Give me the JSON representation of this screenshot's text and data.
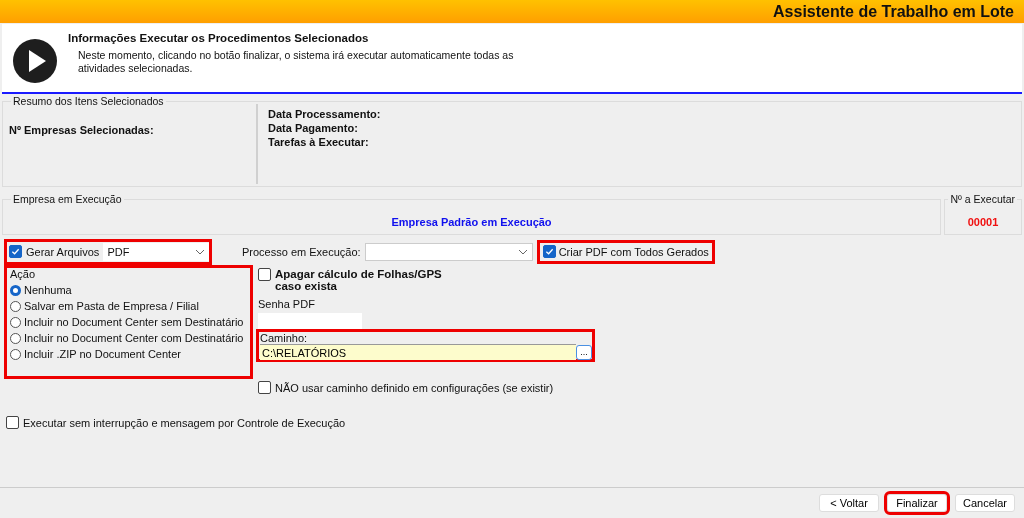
{
  "window": {
    "title": "Assistente de Trabalho em Lote"
  },
  "header": {
    "title": "Informações Executar os Procedimentos Selecionados",
    "description": "Neste momento, clicando no botão finalizar, o sistema irá executar automaticamente todas as atividades selecionadas."
  },
  "summary": {
    "title": "Resumo dos Itens Selecionados",
    "left_labels": [
      "Nº Empresas Selecionadas:"
    ],
    "right_labels": [
      "Data Processamento:",
      "Data Pagamento:",
      "Tarefas à Executar:"
    ]
  },
  "execution": {
    "title": "Empresa em Execução",
    "company": "Empresa Padrão em Execução",
    "counter_title": "Nº a Executar",
    "counter": "00001"
  },
  "generate_files": {
    "label": "Gerar Arquivos",
    "checked": true,
    "format": "PDF",
    "highlighted": true
  },
  "process": {
    "label": "Processo em Execução:"
  },
  "create_pdf": {
    "label": "Criar PDF com Todos Gerados",
    "checked": true,
    "highlighted": true
  },
  "action": {
    "title": "Ação",
    "highlighted": true,
    "options": [
      {
        "label": "Nenhuma",
        "selected": true
      },
      {
        "label": "Salvar em Pasta de Empresa / Filial",
        "selected": false
      },
      {
        "label": "Incluir no Document Center sem Destinatário",
        "selected": false
      },
      {
        "label": "Incluir no Document Center com Destinatário",
        "selected": false
      },
      {
        "label": "Incluir .ZIP no Document Center",
        "selected": false
      }
    ]
  },
  "clear_calc": {
    "label": "Apagar cálculo de Folhas/GPS caso exista",
    "checked": false
  },
  "pdf_password": {
    "label": "Senha PDF"
  },
  "path": {
    "label": "Caminho:",
    "value": "C:\\RELATÓRIOS",
    "button": "...",
    "highlighted": true
  },
  "ignore_path": {
    "label": "NÃO usar caminho definido em configurações (se existir)",
    "checked": false
  },
  "no_interrupt": {
    "label": "Executar sem interrupção e mensagem por Controle de Execução",
    "checked": false
  },
  "buttons": [
    {
      "label": "< Voltar",
      "highlighted": false
    },
    {
      "label": "Finalizar",
      "highlighted": true
    },
    {
      "label": "Cancelar",
      "highlighted": false
    }
  ]
}
